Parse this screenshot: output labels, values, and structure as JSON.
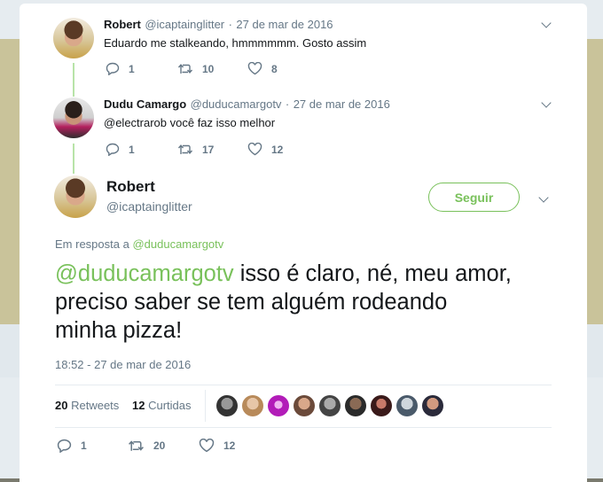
{
  "tweet1": {
    "name": "Robert",
    "handle": "@icaptainglitter",
    "sep": "·",
    "date": "27 de mar de 2016",
    "text": "Eduardo me stalkeando, hmmmmmm. Gosto assim",
    "replies": "1",
    "retweets": "10",
    "likes": "8"
  },
  "tweet2": {
    "name": "Dudu Camargo",
    "handle": "@duducamargotv",
    "sep": "·",
    "date": "27 de mar de 2016",
    "text": "@electrarob você faz isso melhor",
    "replies": "1",
    "retweets": "17",
    "likes": "12"
  },
  "main": {
    "name": "Robert",
    "handle": "@icaptainglitter",
    "follow_label": "Seguir",
    "reply_prefix": "Em resposta a",
    "reply_to": "@duducamargotv",
    "mention": "@duducamargotv",
    "text_line1": " isso é claro, né, meu amor,",
    "text_line2": "preciso saber se tem alguém rodeando",
    "text_line3": "minha pizza!",
    "timestamp": "18:52 - 27 de mar de 2016",
    "retweets_count": "20",
    "retweets_label": "Retweets",
    "likes_count": "12",
    "likes_label": "Curtidas",
    "replies": "1",
    "retweets": "20",
    "likes": "12"
  },
  "colors": {
    "accent": "#79c15b",
    "thread_line": "#b8e3a8",
    "secondary_text": "#657786"
  }
}
